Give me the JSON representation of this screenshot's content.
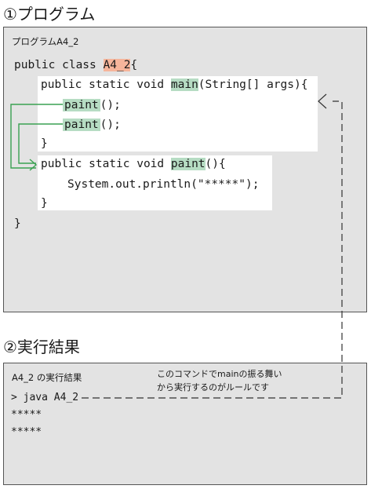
{
  "program_heading": "①プログラム",
  "program_box_label": "プログラムA4_2",
  "code": {
    "class_line_prefix": "public class ",
    "class_name": "A4_2",
    "class_line_suffix": "{",
    "main_prefix": "public static void ",
    "main_name": "main",
    "main_suffix": "(String[] args){",
    "call1_name": "paint",
    "call1_suffix": "();",
    "call2_name": "paint",
    "call2_suffix": "();",
    "main_close": "}",
    "paint_prefix": "public static void ",
    "paint_name": "paint",
    "paint_suffix": "(){",
    "println": "System.out.println(\"*****\");",
    "paint_close": "}",
    "class_close": "}"
  },
  "result_heading": "②実行結果",
  "result_box_label": "A4_2 の実行結果",
  "note_line1": "このコマンドでmainの振る舞い",
  "note_line2": "から実行するのがルールです",
  "command": "> java A4_2",
  "output_line1": "*****",
  "output_line2": "*****"
}
